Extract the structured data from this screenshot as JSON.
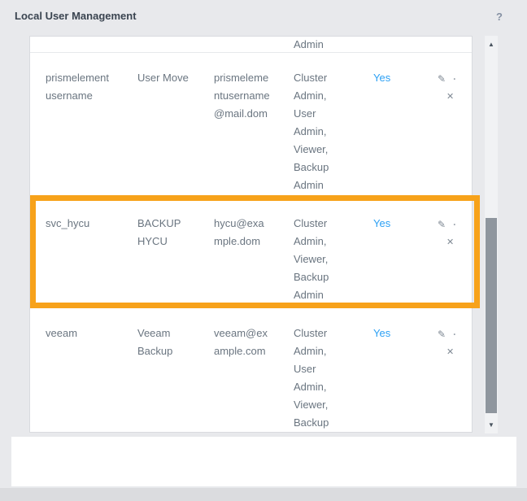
{
  "window": {
    "title": "Local User Management",
    "help_label": "?"
  },
  "table": {
    "clipped_row_tail": "Admin",
    "rows": [
      {
        "username": "prismelementusername",
        "display_name": "User Move",
        "email": "prismelementusername@mail.dom",
        "roles": "Cluster Admin, User Admin, Viewer, Backup Admin",
        "enabled": "Yes"
      },
      {
        "username": "svc_hycu",
        "display_name": "BACKUP HYCU",
        "email": "hycu@example.dom",
        "roles": "Cluster Admin, Viewer, Backup Admin",
        "enabled": "Yes"
      },
      {
        "username": "veeam",
        "display_name": "Veeam Backup",
        "email": "veeam@example.com",
        "roles": "Cluster Admin, User Admin, Viewer, Backup Admin",
        "enabled": "Yes"
      }
    ]
  },
  "icons": {
    "edit": "✎",
    "more": "·",
    "delete": "✕",
    "scroll_up": "▲",
    "scroll_down": "▼"
  },
  "annotation": {
    "highlighted_row": "svc_hycu"
  },
  "colors": {
    "link": "#2CA0F4",
    "highlight": "#F7A21A"
  }
}
